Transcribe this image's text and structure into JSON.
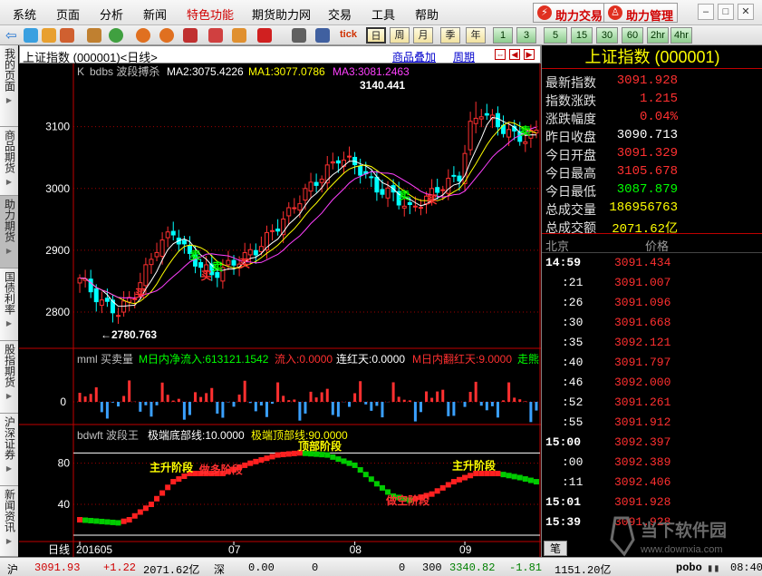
{
  "menu": {
    "items": [
      "系统",
      "页面",
      "分析",
      "新闻",
      "特色功能",
      "期货助力网",
      "交易",
      "工具",
      "帮助"
    ],
    "active_index": 4,
    "trade_btn": "助力交易",
    "manage_btn": "助力管理"
  },
  "toolbar": {
    "period_buttons": [
      "日",
      "周",
      "月",
      "季",
      "年",
      "1",
      "3",
      "5",
      "15",
      "30",
      "60",
      "2hr",
      "4hr"
    ],
    "selected_index": 0,
    "tick_btn": "tick"
  },
  "sidetabs": [
    "我的页面",
    "商品期货",
    "助力期货",
    "国债利率",
    "股指期货",
    "沪深证券",
    "新闻资讯"
  ],
  "chart": {
    "header_title": "上证指数 (000001)<日线>",
    "link_overlay": "商品叠加",
    "link_period": "周期",
    "main_legend": {
      "prefix": "K",
      "name": "bdbs 波段搏杀",
      "ma2": "MA2:3075.4226",
      "ma1": "MA1:3077.0786",
      "ma3": "MA3:3081.2463"
    },
    "high_label": "3140.441",
    "low_label": "2780.763",
    "buy_label": "买",
    "sell_label": "卖",
    "price_axis": [
      "3100",
      "3000",
      "2900",
      "2800"
    ],
    "mml_legend": {
      "name": "mml 买卖量",
      "in_flow": "M日内净流入:613121.1542",
      "flow": "流入:0.0000",
      "red_days": "连红天:0.0000",
      "flip_days": "M日内翻红天:9.0000",
      "tail": "走熊"
    },
    "mml_axis": "0",
    "bdwft_legend": {
      "name": "bdwft 波段王",
      "bottom": "极端底部线:10.0000",
      "top": "极端顶部线:90.0000"
    },
    "bdwft_axis": [
      "80",
      "40"
    ],
    "phase_labels": [
      "主升阶段",
      "做多阶段",
      "顶部阶段",
      "做空阶段",
      "主升阶段"
    ],
    "date_axis": {
      "period_label": "日线",
      "ticks": [
        "201605",
        "07",
        "08",
        "09"
      ]
    }
  },
  "chart_data": [
    {
      "type": "candlestick",
      "title": "上证指数 (000001)<日线>",
      "ylim": [
        2750,
        3170
      ],
      "ticks": [
        2800,
        2900,
        3000,
        3100
      ],
      "high": 3140.441,
      "low": 2780.763,
      "ma": {
        "MA2": 3075.4226,
        "MA1": 3077.0786,
        "MA3": 3081.2463
      },
      "annotations": [
        "3140.441",
        "2780.763"
      ]
    },
    {
      "type": "bar",
      "title": "mml 买卖量",
      "zero_line": 0
    },
    {
      "type": "line",
      "title": "bdwft 波段王",
      "ylim": [
        10,
        100
      ],
      "ticks": [
        40,
        80
      ],
      "reference_lines": {
        "bottom": 10,
        "top": 90
      }
    }
  ],
  "quote": {
    "title": "上证指数 (000001)",
    "rows": [
      {
        "k": "最新指数",
        "v": "3091.928",
        "c": "#ff3030"
      },
      {
        "k": "指数涨跌",
        "v": "1.215",
        "c": "#ff3030"
      },
      {
        "k": "涨跌幅度",
        "v": "0.04%",
        "c": "#ff3030"
      },
      {
        "k": "昨日收盘",
        "v": "3090.713",
        "c": "#ffffff"
      },
      {
        "k": "今日开盘",
        "v": "3091.329",
        "c": "#ff3030"
      },
      {
        "k": "今日最高",
        "v": "3105.678",
        "c": "#ff3030"
      },
      {
        "k": "今日最低",
        "v": "3087.879",
        "c": "#00ff00"
      },
      {
        "k": "总成交量",
        "v": "186956763",
        "c": "#ffff00"
      },
      {
        "k": "总成交额",
        "v": "2071.62亿",
        "c": "#ffff00"
      }
    ],
    "tick_head_left": "北京",
    "tick_head_right": "价格",
    "ticks": [
      {
        "t": "14:59",
        "p": "3091.434",
        "major": true
      },
      {
        "t": ":21",
        "p": "3091.007",
        "major": false
      },
      {
        "t": ":26",
        "p": "3091.096",
        "major": false
      },
      {
        "t": ":30",
        "p": "3091.668",
        "major": false
      },
      {
        "t": ":35",
        "p": "3092.121",
        "major": false
      },
      {
        "t": ":40",
        "p": "3091.797",
        "major": false
      },
      {
        "t": ":46",
        "p": "3092.000",
        "major": false
      },
      {
        "t": ":52",
        "p": "3091.261",
        "major": false
      },
      {
        "t": ":55",
        "p": "3091.912",
        "major": false
      },
      {
        "t": "15:00",
        "p": "3092.397",
        "major": true
      },
      {
        "t": ":00",
        "p": "3092.389",
        "major": false
      },
      {
        "t": ":11",
        "p": "3092.406",
        "major": false
      },
      {
        "t": "15:01",
        "p": "3091.928",
        "major": true
      },
      {
        "t": "15:39",
        "p": "3091.928",
        "major": true
      }
    ],
    "bottom_tab": "笔"
  },
  "status": {
    "sh_label": "沪",
    "sh_price": "3091.93",
    "sh_chg": "+1.22",
    "sh_amt": "2071.62亿",
    "sz_label": "深",
    "sz_price": "0.00",
    "sz_chg": "0",
    "sz_amt": "0",
    "i300_label": "300",
    "i300_price": "3340.82",
    "i300_chg": "-1.81",
    "i300_amt": "1151.20亿",
    "brand": "pobo",
    "time": "08:40"
  },
  "watermark": {
    "text": "当下软件园",
    "url": "www.downxia.com"
  },
  "colors": {
    "up": "#ff3030",
    "down": "#00ffff",
    "ma1": "#ffff00",
    "ma2": "#ffffff",
    "ma3": "#ff40ff",
    "bdwft_up": "#ff2020",
    "bdwft_down": "#00cc00"
  }
}
